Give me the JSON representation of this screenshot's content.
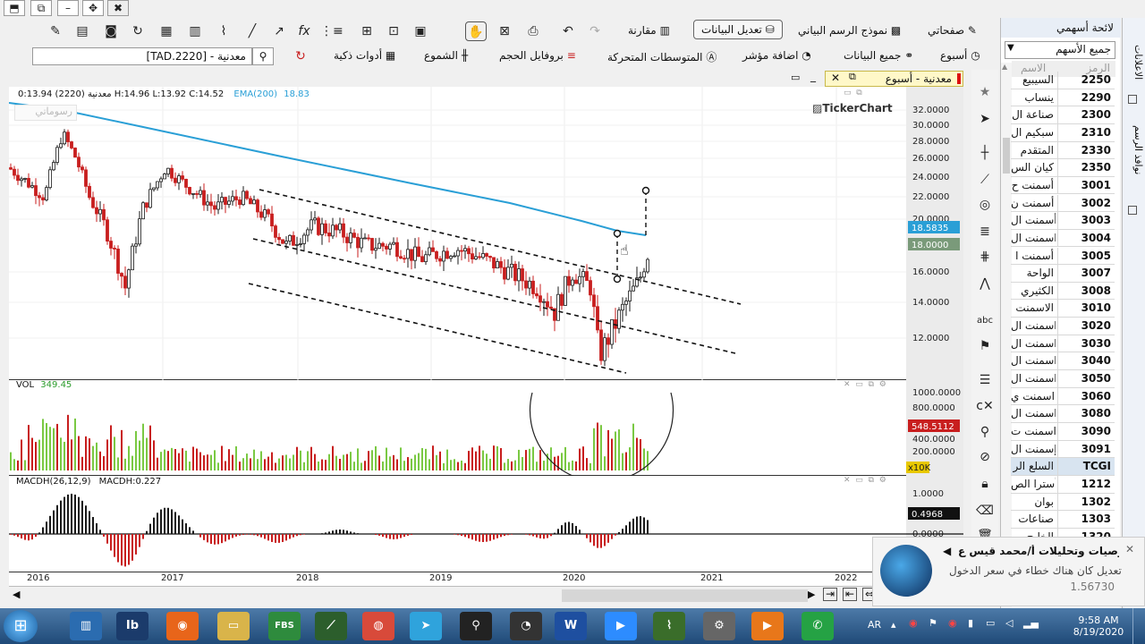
{
  "toolbar_row1": {
    "my_pages": "صفحاتي",
    "chart_template": "نموذج الرسم البياني",
    "edit_data": "تعديل البيانات",
    "compare": "مقارنة"
  },
  "toolbar_row2": {
    "search_value": "[TAD.2220] - معدنية",
    "smart_tools": "أدوات ذكية",
    "candles": "الشموع",
    "volume_profile": "بروفايل الحجم",
    "moving_averages": "المتوسطات المتحركة",
    "add_indicator": "اضافة مؤشر",
    "all_data": "جميع البيانات",
    "period": "أسبوع"
  },
  "chart_tab": {
    "title": "معدنية - أسبوع"
  },
  "price_pane": {
    "header_name": "معدنية",
    "header_code": "(2220)",
    "ohlc": "0:13.94  H:14.96  L:13.92  C:14.52",
    "ema_label": "EMA(200)",
    "ema_value": "18.83",
    "watermark_label": "رسوماتي",
    "brand": "TickerChart",
    "ema_badge": "18.5835",
    "close_badge": "18.0000",
    "y_ticks": [
      "32.0000",
      "30.0000",
      "28.0000",
      "26.0000",
      "24.0000",
      "22.0000",
      "20.0000",
      "16.0000",
      "14.0000",
      "12.0000"
    ],
    "colors": {
      "ema": "#2a9fd6",
      "up": "#1a1a1a",
      "down": "#c81e1e"
    }
  },
  "volume_pane": {
    "label": "VOL",
    "value": "349.45",
    "badge": "548.5112",
    "multiplier": "x10K",
    "y_ticks": [
      "1000.0000",
      "800.0000",
      "400.0000",
      "200.0000",
      "00"
    ]
  },
  "macd_pane": {
    "label": "MACDH(26,12,9)",
    "value_label": "MACDH:0.227",
    "badge": "0.4968",
    "y_ticks": [
      "1.0000",
      "0.0000"
    ]
  },
  "x_axis": {
    "years": [
      "2016",
      "2017",
      "2018",
      "2019",
      "2020",
      "2021",
      "2022"
    ]
  },
  "left_tabs": {
    "favorites": "المفضلة",
    "chart_windows": "نوافذ الرسم",
    "announcements": "الاعلانات"
  },
  "watchlist": {
    "title": "لائحة أسهمي",
    "filter": "جميع الأسهم",
    "col_symbol": "الرمز",
    "col_name": "الاسم",
    "rows": [
      {
        "sym": "2250",
        "name": "السيبيع"
      },
      {
        "sym": "2290",
        "name": "ينساب"
      },
      {
        "sym": "2300",
        "name": "صناعة ال"
      },
      {
        "sym": "2310",
        "name": "سبكيم ال"
      },
      {
        "sym": "2330",
        "name": "المتقدم"
      },
      {
        "sym": "2350",
        "name": "كيان الس"
      },
      {
        "sym": "3001",
        "name": "أسمنت ح"
      },
      {
        "sym": "3002",
        "name": "أسمنت ن"
      },
      {
        "sym": "3003",
        "name": "أسمنت ال"
      },
      {
        "sym": "3004",
        "name": "اسمنت ال"
      },
      {
        "sym": "3005",
        "name": "أسمنت ا"
      },
      {
        "sym": "3007",
        "name": "الواحة"
      },
      {
        "sym": "3008",
        "name": "الكثيري"
      },
      {
        "sym": "3010",
        "name": "الاسمنت"
      },
      {
        "sym": "3020",
        "name": "اسمنت ال"
      },
      {
        "sym": "3030",
        "name": "اسمنت ال"
      },
      {
        "sym": "3040",
        "name": "اسمنت ال"
      },
      {
        "sym": "3050",
        "name": "اسمنت ال"
      },
      {
        "sym": "3060",
        "name": "اسمنت ي"
      },
      {
        "sym": "3080",
        "name": "اسمنت ال"
      },
      {
        "sym": "3090",
        "name": "اسمنت ت"
      },
      {
        "sym": "3091",
        "name": "إسمنت ال"
      },
      {
        "sym": "TCGI",
        "name": "السلع الر"
      },
      {
        "sym": "1212",
        "name": "أسترا الص"
      },
      {
        "sym": "1302",
        "name": "بوان"
      },
      {
        "sym": "1303",
        "name": "صناعات"
      },
      {
        "sym": "1320",
        "name": "الخليج"
      }
    ]
  },
  "notification": {
    "title": "توصيات وتحليلات أ/محمد قيس ع...",
    "body": "تعديل كان هناك خطاء في سعر الدخول",
    "value": "1.56730"
  },
  "taskbar": {
    "time": "9:58 AM",
    "date": "8/19/2020",
    "lang": "AR",
    "apps": [
      "explorer",
      "ib",
      "firefox",
      "folder",
      "fbs",
      "metatrader",
      "chrome",
      "telegram",
      "pin",
      "speed",
      "word",
      "zoom",
      "chart",
      "tool",
      "media",
      "whatsapp"
    ],
    "fbs_label": "FBS",
    "word_label": "W"
  }
}
